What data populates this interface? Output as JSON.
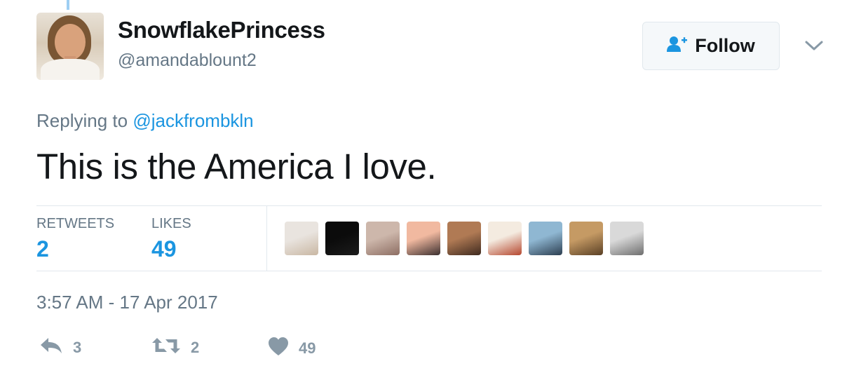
{
  "author": {
    "display_name": "SnowflakePrincess",
    "handle": "@amandablount2"
  },
  "follow_button": {
    "label": "Follow"
  },
  "reply_context": {
    "prefix": "Replying to",
    "mention": "@jackfrombkln"
  },
  "tweet": {
    "text": "This is the America I love."
  },
  "stats": {
    "retweets_label": "RETWEETS",
    "retweets_value": "2",
    "likes_label": "LIKES",
    "likes_value": "49"
  },
  "liker_avatars": [
    {
      "icon": "avatar-blonde-woman",
      "colors": [
        "#e9e4df",
        "#c9b7a3"
      ]
    },
    {
      "icon": "avatar-black-cat",
      "colors": [
        "#0b0b0b",
        "#1c1c1c"
      ]
    },
    {
      "icon": "avatar-woman-selfie",
      "colors": [
        "#cdb7ab",
        "#8d6e63"
      ]
    },
    {
      "icon": "avatar-sunset",
      "colors": [
        "#f1b9a0",
        "#3b2f2f"
      ]
    },
    {
      "icon": "avatar-woman-blur",
      "colors": [
        "#b07a54",
        "#3f2a1f"
      ]
    },
    {
      "icon": "avatar-bill-the-cat",
      "colors": [
        "#f4ebe0",
        "#b5472e"
      ]
    },
    {
      "icon": "avatar-woman-boat",
      "colors": [
        "#8fb7d2",
        "#2c3e50"
      ]
    },
    {
      "icon": "avatar-cat-photo",
      "colors": [
        "#c59a64",
        "#5a4025"
      ]
    },
    {
      "icon": "avatar-wine-glasses",
      "colors": [
        "#d9d9d9",
        "#6e6e6e"
      ]
    }
  ],
  "timestamp": "3:57 AM - 17 Apr 2017",
  "actions": {
    "reply_count": "3",
    "retweet_count": "2",
    "like_count": "49"
  },
  "colors": {
    "accent": "#1b95e0",
    "muted": "#657786",
    "icon_gray": "#8899a6"
  }
}
